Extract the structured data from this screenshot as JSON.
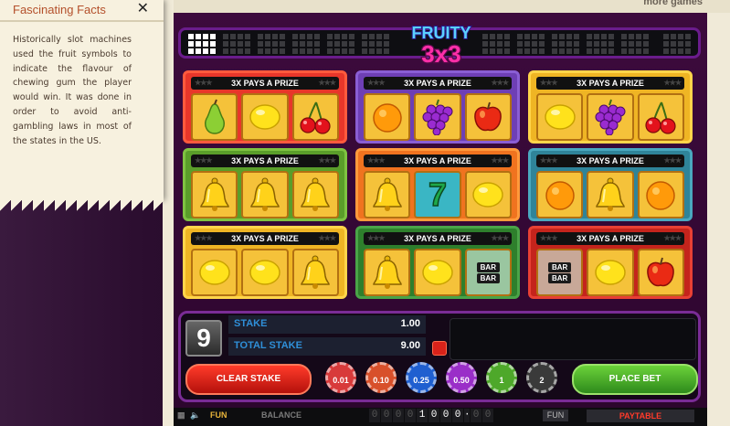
{
  "top": {
    "more_games": "more games"
  },
  "facts": {
    "title": "Fascinating Facts",
    "close": "✕",
    "body": "Historically slot machines used the fruit symbols to indicate the flavour of chewing gum the player would win. It was done in order to avoid anti-gambling laws in most of the states in the US."
  },
  "logo": {
    "line1": "FRUITY",
    "line2": "3x3"
  },
  "reels": {
    "banner": "3X PAYS A PRIZE",
    "panels": [
      {
        "theme": "red",
        "symbols": [
          "pear-icon",
          "lemon-icon",
          "cherry-icon"
        ]
      },
      {
        "theme": "purple",
        "symbols": [
          "orange-icon",
          "grapes-icon",
          "apple-icon"
        ]
      },
      {
        "theme": "yellow",
        "symbols": [
          "lemon-icon",
          "grapes-icon",
          "cherry-icon"
        ]
      },
      {
        "theme": "green",
        "symbols": [
          "bell-icon",
          "bell-icon",
          "bell-icon"
        ]
      },
      {
        "theme": "orange",
        "symbols": [
          "bell-icon",
          "seven-icon",
          "lemon-icon"
        ]
      },
      {
        "theme": "teal",
        "symbols": [
          "orange-icon",
          "bell-icon",
          "orange-icon"
        ]
      },
      {
        "theme": "yellow",
        "symbols": [
          "lemon-icon",
          "lemon-icon",
          "bell-icon"
        ]
      },
      {
        "theme": "darkgreen",
        "symbols": [
          "bell-icon",
          "lemon-icon",
          "bar-icon"
        ]
      },
      {
        "theme": "darkred",
        "symbols": [
          "bar-icon",
          "lemon-icon",
          "apple-icon"
        ]
      }
    ],
    "seven_text": "7",
    "bar_text": "BAR"
  },
  "controls": {
    "lines": "9",
    "stake_label": "STAKE",
    "stake_value": "1.00",
    "total_label": "TOTAL STAKE",
    "total_value": "9.00",
    "clear_label": "CLEAR STAKE",
    "place_label": "PLACE BET",
    "chips": [
      {
        "label": "0.01",
        "color": "#d83a3a"
      },
      {
        "label": "0.10",
        "color": "#d8502a"
      },
      {
        "label": "0.25",
        "color": "#1f5fd0"
      },
      {
        "label": "0.50",
        "color": "#9a2ec8"
      },
      {
        "label": "1",
        "color": "#4ea82a"
      },
      {
        "label": "2",
        "color": "#3a3a3a"
      }
    ]
  },
  "bottom": {
    "fun": "FUN",
    "balance_label": "BALANCE",
    "balance_digits": [
      "0",
      "0",
      "0",
      "0",
      "1",
      "0",
      "0",
      "0",
      "0",
      "0"
    ],
    "balance_sep": "·",
    "currency": "FUN",
    "paytable": "PAYTABLE"
  },
  "colors": {
    "panel_red": "#e8362a",
    "panel_purple": "#6e3fb5",
    "panel_yellow": "#efb524",
    "panel_green": "#5a9e2a",
    "panel_orange": "#f0731f",
    "panel_teal": "#2f8499"
  }
}
